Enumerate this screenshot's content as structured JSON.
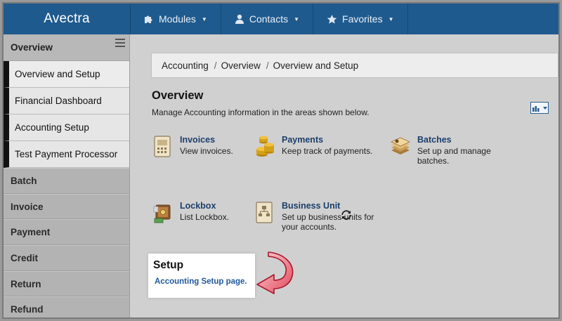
{
  "app": {
    "brand": "Avectra"
  },
  "topnav": [
    {
      "label": "Modules",
      "icon": "puzzle-icon"
    },
    {
      "label": "Contacts",
      "icon": "user-icon"
    },
    {
      "label": "Favorites",
      "icon": "star-icon"
    }
  ],
  "sidebar": {
    "header": "Overview",
    "subitems": [
      {
        "label": "Overview and Setup"
      },
      {
        "label": "Financial Dashboard"
      },
      {
        "label": "Accounting Setup"
      },
      {
        "label": "Test Payment Processor"
      }
    ],
    "items": [
      {
        "label": "Batch"
      },
      {
        "label": "Invoice"
      },
      {
        "label": "Payment"
      },
      {
        "label": "Credit"
      },
      {
        "label": "Return"
      },
      {
        "label": "Refund"
      }
    ]
  },
  "breadcrumb": [
    "Accounting",
    "Overview",
    "Overview and Setup"
  ],
  "overview": {
    "title": "Overview",
    "description": "Manage Accounting information in the areas shown below."
  },
  "tiles": [
    {
      "title": "Invoices",
      "desc": "View invoices.",
      "icon": "invoice-icon"
    },
    {
      "title": "Payments",
      "desc": "Keep track of payments.",
      "icon": "coins-icon"
    },
    {
      "title": "Batches",
      "desc": "Set up and manage batches.",
      "icon": "batch-stack-icon"
    },
    {
      "title": "Lockbox",
      "desc": "List Lockbox.",
      "icon": "lockbox-icon"
    },
    {
      "title": "Business Unit",
      "desc": "Set up business units for your accounts.",
      "icon": "org-chart-icon"
    }
  ],
  "setup": {
    "title": "Setup",
    "link": "Accounting Setup page."
  },
  "colors": {
    "topbar": "#1f5a8e",
    "link": "#1f5a9a",
    "tile_title": "#1c3f6b",
    "arrow": "#e0475a"
  }
}
